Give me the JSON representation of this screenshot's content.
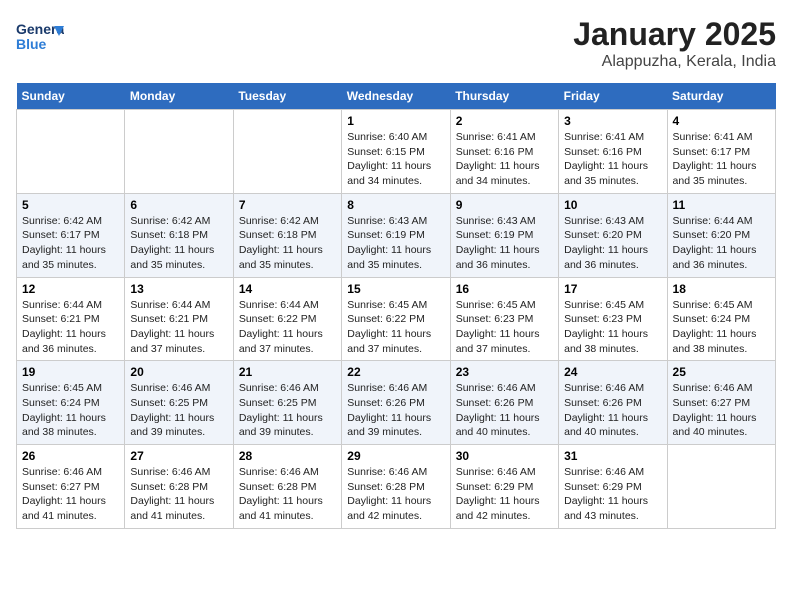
{
  "header": {
    "logo_general": "General",
    "logo_blue": "Blue",
    "title": "January 2025",
    "subtitle": "Alappuzha, Kerala, India"
  },
  "days_of_week": [
    "Sunday",
    "Monday",
    "Tuesday",
    "Wednesday",
    "Thursday",
    "Friday",
    "Saturday"
  ],
  "weeks": [
    [
      {
        "day": "",
        "info": ""
      },
      {
        "day": "",
        "info": ""
      },
      {
        "day": "",
        "info": ""
      },
      {
        "day": "1",
        "info": "Sunrise: 6:40 AM\nSunset: 6:15 PM\nDaylight: 11 hours and 34 minutes."
      },
      {
        "day": "2",
        "info": "Sunrise: 6:41 AM\nSunset: 6:16 PM\nDaylight: 11 hours and 34 minutes."
      },
      {
        "day": "3",
        "info": "Sunrise: 6:41 AM\nSunset: 6:16 PM\nDaylight: 11 hours and 35 minutes."
      },
      {
        "day": "4",
        "info": "Sunrise: 6:41 AM\nSunset: 6:17 PM\nDaylight: 11 hours and 35 minutes."
      }
    ],
    [
      {
        "day": "5",
        "info": "Sunrise: 6:42 AM\nSunset: 6:17 PM\nDaylight: 11 hours and 35 minutes."
      },
      {
        "day": "6",
        "info": "Sunrise: 6:42 AM\nSunset: 6:18 PM\nDaylight: 11 hours and 35 minutes."
      },
      {
        "day": "7",
        "info": "Sunrise: 6:42 AM\nSunset: 6:18 PM\nDaylight: 11 hours and 35 minutes."
      },
      {
        "day": "8",
        "info": "Sunrise: 6:43 AM\nSunset: 6:19 PM\nDaylight: 11 hours and 35 minutes."
      },
      {
        "day": "9",
        "info": "Sunrise: 6:43 AM\nSunset: 6:19 PM\nDaylight: 11 hours and 36 minutes."
      },
      {
        "day": "10",
        "info": "Sunrise: 6:43 AM\nSunset: 6:20 PM\nDaylight: 11 hours and 36 minutes."
      },
      {
        "day": "11",
        "info": "Sunrise: 6:44 AM\nSunset: 6:20 PM\nDaylight: 11 hours and 36 minutes."
      }
    ],
    [
      {
        "day": "12",
        "info": "Sunrise: 6:44 AM\nSunset: 6:21 PM\nDaylight: 11 hours and 36 minutes."
      },
      {
        "day": "13",
        "info": "Sunrise: 6:44 AM\nSunset: 6:21 PM\nDaylight: 11 hours and 37 minutes."
      },
      {
        "day": "14",
        "info": "Sunrise: 6:44 AM\nSunset: 6:22 PM\nDaylight: 11 hours and 37 minutes."
      },
      {
        "day": "15",
        "info": "Sunrise: 6:45 AM\nSunset: 6:22 PM\nDaylight: 11 hours and 37 minutes."
      },
      {
        "day": "16",
        "info": "Sunrise: 6:45 AM\nSunset: 6:23 PM\nDaylight: 11 hours and 37 minutes."
      },
      {
        "day": "17",
        "info": "Sunrise: 6:45 AM\nSunset: 6:23 PM\nDaylight: 11 hours and 38 minutes."
      },
      {
        "day": "18",
        "info": "Sunrise: 6:45 AM\nSunset: 6:24 PM\nDaylight: 11 hours and 38 minutes."
      }
    ],
    [
      {
        "day": "19",
        "info": "Sunrise: 6:45 AM\nSunset: 6:24 PM\nDaylight: 11 hours and 38 minutes."
      },
      {
        "day": "20",
        "info": "Sunrise: 6:46 AM\nSunset: 6:25 PM\nDaylight: 11 hours and 39 minutes."
      },
      {
        "day": "21",
        "info": "Sunrise: 6:46 AM\nSunset: 6:25 PM\nDaylight: 11 hours and 39 minutes."
      },
      {
        "day": "22",
        "info": "Sunrise: 6:46 AM\nSunset: 6:26 PM\nDaylight: 11 hours and 39 minutes."
      },
      {
        "day": "23",
        "info": "Sunrise: 6:46 AM\nSunset: 6:26 PM\nDaylight: 11 hours and 40 minutes."
      },
      {
        "day": "24",
        "info": "Sunrise: 6:46 AM\nSunset: 6:26 PM\nDaylight: 11 hours and 40 minutes."
      },
      {
        "day": "25",
        "info": "Sunrise: 6:46 AM\nSunset: 6:27 PM\nDaylight: 11 hours and 40 minutes."
      }
    ],
    [
      {
        "day": "26",
        "info": "Sunrise: 6:46 AM\nSunset: 6:27 PM\nDaylight: 11 hours and 41 minutes."
      },
      {
        "day": "27",
        "info": "Sunrise: 6:46 AM\nSunset: 6:28 PM\nDaylight: 11 hours and 41 minutes."
      },
      {
        "day": "28",
        "info": "Sunrise: 6:46 AM\nSunset: 6:28 PM\nDaylight: 11 hours and 41 minutes."
      },
      {
        "day": "29",
        "info": "Sunrise: 6:46 AM\nSunset: 6:28 PM\nDaylight: 11 hours and 42 minutes."
      },
      {
        "day": "30",
        "info": "Sunrise: 6:46 AM\nSunset: 6:29 PM\nDaylight: 11 hours and 42 minutes."
      },
      {
        "day": "31",
        "info": "Sunrise: 6:46 AM\nSunset: 6:29 PM\nDaylight: 11 hours and 43 minutes."
      },
      {
        "day": "",
        "info": ""
      }
    ]
  ]
}
